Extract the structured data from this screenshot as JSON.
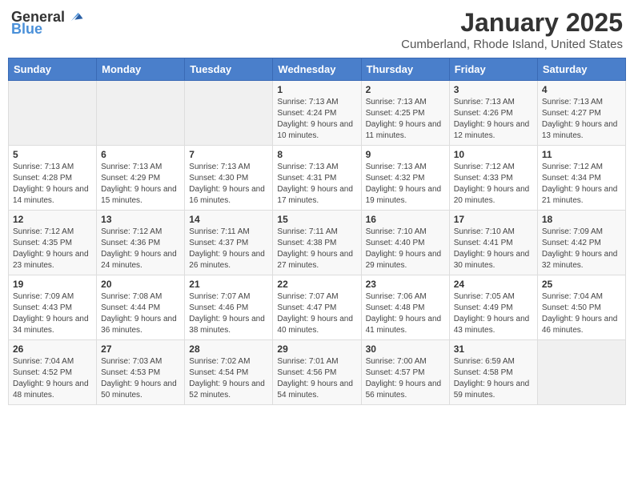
{
  "header": {
    "logo_general": "General",
    "logo_blue": "Blue",
    "title": "January 2025",
    "subtitle": "Cumberland, Rhode Island, United States"
  },
  "weekdays": [
    "Sunday",
    "Monday",
    "Tuesday",
    "Wednesday",
    "Thursday",
    "Friday",
    "Saturday"
  ],
  "weeks": [
    [
      {
        "day": "",
        "info": ""
      },
      {
        "day": "",
        "info": ""
      },
      {
        "day": "",
        "info": ""
      },
      {
        "day": "1",
        "info": "Sunrise: 7:13 AM\nSunset: 4:24 PM\nDaylight: 9 hours and 10 minutes."
      },
      {
        "day": "2",
        "info": "Sunrise: 7:13 AM\nSunset: 4:25 PM\nDaylight: 9 hours and 11 minutes."
      },
      {
        "day": "3",
        "info": "Sunrise: 7:13 AM\nSunset: 4:26 PM\nDaylight: 9 hours and 12 minutes."
      },
      {
        "day": "4",
        "info": "Sunrise: 7:13 AM\nSunset: 4:27 PM\nDaylight: 9 hours and 13 minutes."
      }
    ],
    [
      {
        "day": "5",
        "info": "Sunrise: 7:13 AM\nSunset: 4:28 PM\nDaylight: 9 hours and 14 minutes."
      },
      {
        "day": "6",
        "info": "Sunrise: 7:13 AM\nSunset: 4:29 PM\nDaylight: 9 hours and 15 minutes."
      },
      {
        "day": "7",
        "info": "Sunrise: 7:13 AM\nSunset: 4:30 PM\nDaylight: 9 hours and 16 minutes."
      },
      {
        "day": "8",
        "info": "Sunrise: 7:13 AM\nSunset: 4:31 PM\nDaylight: 9 hours and 17 minutes."
      },
      {
        "day": "9",
        "info": "Sunrise: 7:13 AM\nSunset: 4:32 PM\nDaylight: 9 hours and 19 minutes."
      },
      {
        "day": "10",
        "info": "Sunrise: 7:12 AM\nSunset: 4:33 PM\nDaylight: 9 hours and 20 minutes."
      },
      {
        "day": "11",
        "info": "Sunrise: 7:12 AM\nSunset: 4:34 PM\nDaylight: 9 hours and 21 minutes."
      }
    ],
    [
      {
        "day": "12",
        "info": "Sunrise: 7:12 AM\nSunset: 4:35 PM\nDaylight: 9 hours and 23 minutes."
      },
      {
        "day": "13",
        "info": "Sunrise: 7:12 AM\nSunset: 4:36 PM\nDaylight: 9 hours and 24 minutes."
      },
      {
        "day": "14",
        "info": "Sunrise: 7:11 AM\nSunset: 4:37 PM\nDaylight: 9 hours and 26 minutes."
      },
      {
        "day": "15",
        "info": "Sunrise: 7:11 AM\nSunset: 4:38 PM\nDaylight: 9 hours and 27 minutes."
      },
      {
        "day": "16",
        "info": "Sunrise: 7:10 AM\nSunset: 4:40 PM\nDaylight: 9 hours and 29 minutes."
      },
      {
        "day": "17",
        "info": "Sunrise: 7:10 AM\nSunset: 4:41 PM\nDaylight: 9 hours and 30 minutes."
      },
      {
        "day": "18",
        "info": "Sunrise: 7:09 AM\nSunset: 4:42 PM\nDaylight: 9 hours and 32 minutes."
      }
    ],
    [
      {
        "day": "19",
        "info": "Sunrise: 7:09 AM\nSunset: 4:43 PM\nDaylight: 9 hours and 34 minutes."
      },
      {
        "day": "20",
        "info": "Sunrise: 7:08 AM\nSunset: 4:44 PM\nDaylight: 9 hours and 36 minutes."
      },
      {
        "day": "21",
        "info": "Sunrise: 7:07 AM\nSunset: 4:46 PM\nDaylight: 9 hours and 38 minutes."
      },
      {
        "day": "22",
        "info": "Sunrise: 7:07 AM\nSunset: 4:47 PM\nDaylight: 9 hours and 40 minutes."
      },
      {
        "day": "23",
        "info": "Sunrise: 7:06 AM\nSunset: 4:48 PM\nDaylight: 9 hours and 41 minutes."
      },
      {
        "day": "24",
        "info": "Sunrise: 7:05 AM\nSunset: 4:49 PM\nDaylight: 9 hours and 43 minutes."
      },
      {
        "day": "25",
        "info": "Sunrise: 7:04 AM\nSunset: 4:50 PM\nDaylight: 9 hours and 46 minutes."
      }
    ],
    [
      {
        "day": "26",
        "info": "Sunrise: 7:04 AM\nSunset: 4:52 PM\nDaylight: 9 hours and 48 minutes."
      },
      {
        "day": "27",
        "info": "Sunrise: 7:03 AM\nSunset: 4:53 PM\nDaylight: 9 hours and 50 minutes."
      },
      {
        "day": "28",
        "info": "Sunrise: 7:02 AM\nSunset: 4:54 PM\nDaylight: 9 hours and 52 minutes."
      },
      {
        "day": "29",
        "info": "Sunrise: 7:01 AM\nSunset: 4:56 PM\nDaylight: 9 hours and 54 minutes."
      },
      {
        "day": "30",
        "info": "Sunrise: 7:00 AM\nSunset: 4:57 PM\nDaylight: 9 hours and 56 minutes."
      },
      {
        "day": "31",
        "info": "Sunrise: 6:59 AM\nSunset: 4:58 PM\nDaylight: 9 hours and 59 minutes."
      },
      {
        "day": "",
        "info": ""
      }
    ]
  ]
}
